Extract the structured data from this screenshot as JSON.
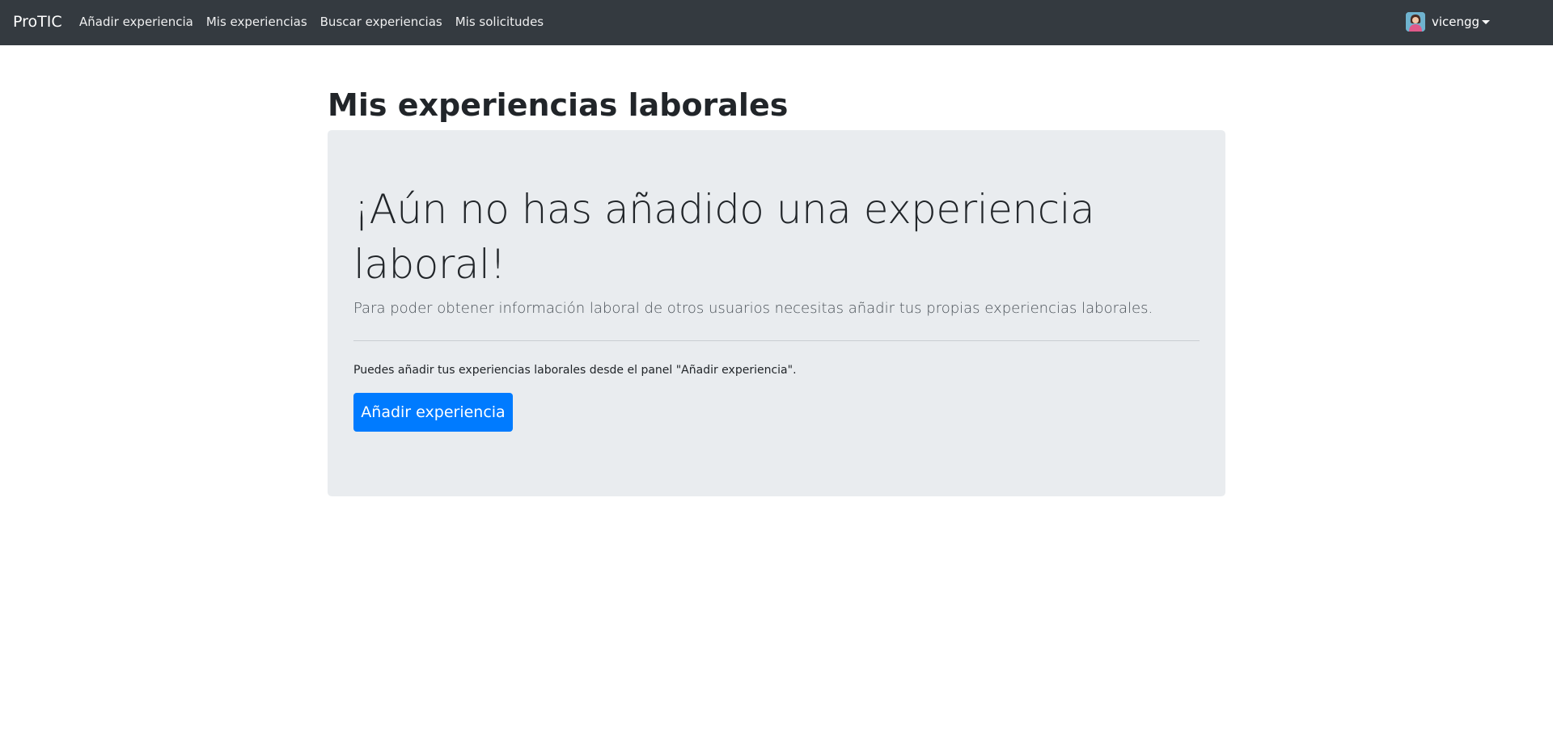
{
  "navbar": {
    "brand": "ProTIC",
    "links": [
      {
        "label": "Añadir experiencia"
      },
      {
        "label": "Mis experiencias"
      },
      {
        "label": "Buscar experiencias"
      },
      {
        "label": "Mis solicitudes"
      }
    ],
    "user": {
      "name": "vicengg",
      "avatar_icon": "user-avatar-icon"
    },
    "colors": {
      "background": "#343a40",
      "text": "#ffffff"
    }
  },
  "main": {
    "title": "Mis experiencias laborales",
    "jumbotron": {
      "heading": "¡Aún no has añadido una experiencia laboral!",
      "lead": "Para poder obtener información laboral de otros usuarios necesitas añadir tus propias experiencias laborales.",
      "hint": "Puedes añadir tus experiencias laborales desde el panel \"Añadir experiencia\".",
      "button_label": "Añadir experiencia",
      "colors": {
        "background": "#e9ecef",
        "button": "#007bff"
      }
    }
  }
}
